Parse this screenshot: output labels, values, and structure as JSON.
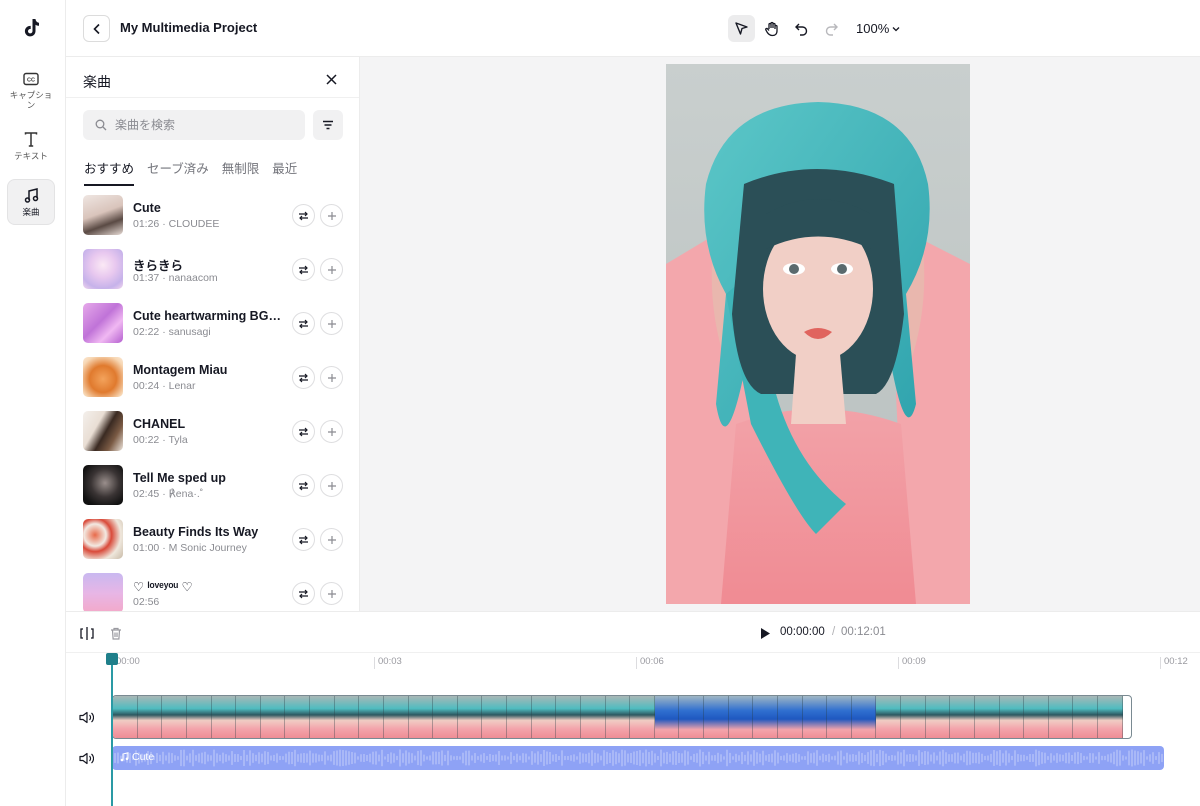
{
  "app": {
    "project_title": "My Multimedia Project",
    "zoom_label": "100%"
  },
  "rail": {
    "items": [
      {
        "label": "キャプション",
        "icon": "captions-icon"
      },
      {
        "label": "テキスト",
        "icon": "text-icon"
      },
      {
        "label": "楽曲",
        "icon": "music-icon"
      }
    ]
  },
  "music_panel": {
    "title": "楽曲",
    "search_placeholder": "楽曲を検索",
    "tabs": [
      "おすすめ",
      "セーブ済み",
      "無制限",
      "最近"
    ],
    "tracks": [
      {
        "name": "Cute",
        "duration": "01:26",
        "artist": "CLOUDEE"
      },
      {
        "name": "きらきら",
        "duration": "01:37",
        "artist": "nanaacom"
      },
      {
        "name": "Cute heartwarming BGM...",
        "duration": "02:22",
        "artist": "sanusagi"
      },
      {
        "name": "Montagem Miau",
        "duration": "00:24",
        "artist": "Lenar"
      },
      {
        "name": "CHANEL",
        "duration": "00:22",
        "artist": "Tyla"
      },
      {
        "name": "Tell Me sped up",
        "duration": "02:45",
        "artist": "℟ena·.˚"
      },
      {
        "name": "Beauty Finds Its Way",
        "duration": "01:00",
        "artist": "M Sonic Journey"
      },
      {
        "name": "♡ ˡᵒᵛᵉʸᵒᵘ ♡",
        "duration": "02:56",
        "artist": ""
      }
    ]
  },
  "playback": {
    "current": "00:00:00",
    "separator": "/",
    "total": "00:12:01"
  },
  "timeline": {
    "ruler": [
      "00:00",
      "00:03",
      "00:06",
      "00:09",
      "00:12"
    ],
    "audio_clip_label": "Cute"
  },
  "colors": {
    "accent": "#1f7f8a",
    "audio_clip": "#8ea2f5",
    "canvas_bg": "#f4f4f5"
  }
}
